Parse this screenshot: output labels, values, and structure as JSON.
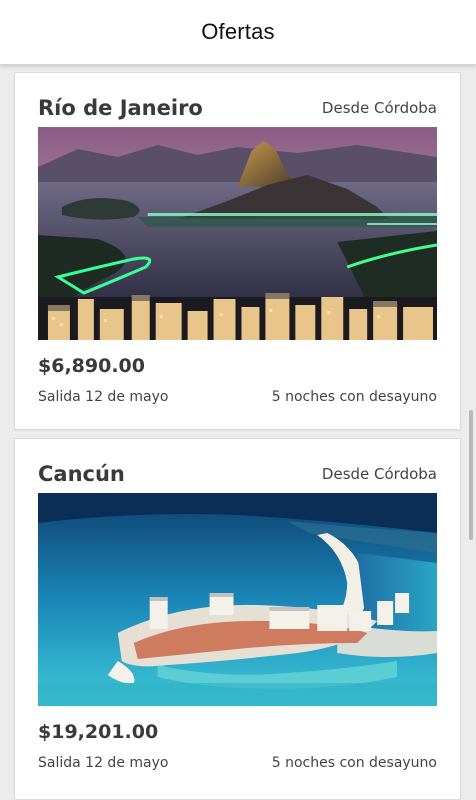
{
  "header": {
    "title": "Ofertas"
  },
  "offers": [
    {
      "destination": "Río de Janeiro",
      "origin": "Desde Córdoba",
      "price": "$6,890.00",
      "departure": "Salida 12 de mayo",
      "package": "5 noches con desayuno",
      "photo": "rio-de-janeiro-photo"
    },
    {
      "destination": "Cancún",
      "origin": "Desde Córdoba",
      "price": "$19,201.00",
      "departure": "Salida 12 de mayo",
      "package": "5 noches con desayuno",
      "photo": "cancun-photo"
    }
  ]
}
